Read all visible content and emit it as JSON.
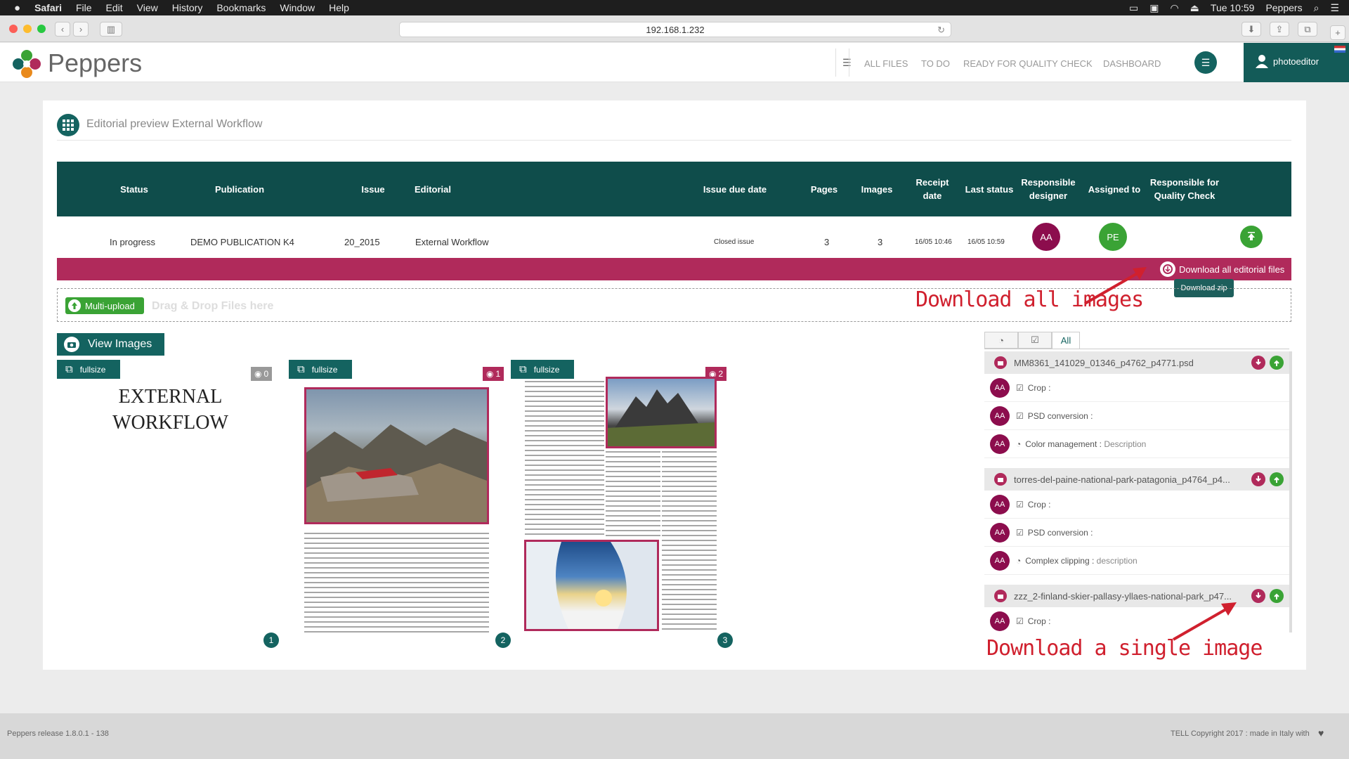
{
  "menubar": {
    "app": "Safari",
    "items": [
      "File",
      "Edit",
      "View",
      "History",
      "Bookmarks",
      "Window",
      "Help"
    ],
    "clock": "Tue 10:59",
    "user": "Peppers"
  },
  "browser": {
    "url": "192.168.1.232"
  },
  "header": {
    "brand": "Peppers",
    "nav": [
      "ALL FILES",
      "TO DO",
      "READY FOR QUALITY CHECK",
      "DASHBOARD"
    ],
    "username": "photoeditor"
  },
  "page": {
    "title": "Editorial preview External Workflow"
  },
  "table": {
    "headers": {
      "status": "Status",
      "publication": "Publication",
      "issue": "Issue",
      "editorial": "Editorial",
      "due": "Issue due date",
      "pages": "Pages",
      "images": "Images",
      "receipt": "Receipt date",
      "last": "Last status",
      "designer": "Responsible designer",
      "assigned": "Assigned to",
      "qc": "Responsible for Quality Check"
    },
    "row": {
      "status": "In progress",
      "publication": "DEMO PUBLICATION K4",
      "issue": "20_2015",
      "editorial": "External Workflow",
      "due": "Closed issue",
      "pages": "3",
      "images": "3",
      "receipt": "16/05 10:46",
      "last": "16/05 10:59",
      "designer_initials": "AA",
      "assigned_initials": "PE"
    }
  },
  "download_bar": {
    "label": "Download all editorial files",
    "tooltip": "Download zip"
  },
  "upload": {
    "button": "Multi-upload",
    "hint": "Drag & Drop Files here"
  },
  "preview": {
    "view_images": "View Images",
    "fullsize": "fullsize",
    "cover_text_1": "EXTERNAL",
    "cover_text_2": "WORKFLOW",
    "badges": [
      "0",
      "1",
      "2"
    ],
    "page_numbers": [
      "1",
      "2",
      "3"
    ]
  },
  "panel": {
    "tab_all": "All",
    "files": [
      {
        "name": "MM8361_141029_01346_p4762_p4771.psd",
        "tasks": [
          {
            "icon": "check",
            "label": "Crop :",
            "desc": ""
          },
          {
            "icon": "check",
            "label": "PSD conversion :",
            "desc": ""
          },
          {
            "icon": "clock",
            "label": "Color management :",
            "desc": "Description"
          }
        ]
      },
      {
        "name": "torres-del-paine-national-park-patagonia_p4764_p4...",
        "tasks": [
          {
            "icon": "check",
            "label": "Crop :",
            "desc": ""
          },
          {
            "icon": "check",
            "label": "PSD conversion :",
            "desc": ""
          },
          {
            "icon": "clock",
            "label": "Complex clipping :",
            "desc": "description"
          }
        ]
      },
      {
        "name": "zzz_2-finland-skier-pallasy-yllaes-national-park_p47...",
        "tasks": [
          {
            "icon": "check",
            "label": "Crop :",
            "desc": ""
          }
        ]
      }
    ],
    "task_initials": "AA"
  },
  "annotations": {
    "all": "Download all images",
    "single": "Download a single image"
  },
  "footer": {
    "left": "Peppers release 1.8.0.1 - 138",
    "right": "TELL Copyright 2017 : made in Italy with"
  },
  "colors": {
    "teal": "#0f4d4b",
    "magenta": "#b02a5b",
    "green": "#3aa335",
    "annotation": "#d0202e"
  }
}
